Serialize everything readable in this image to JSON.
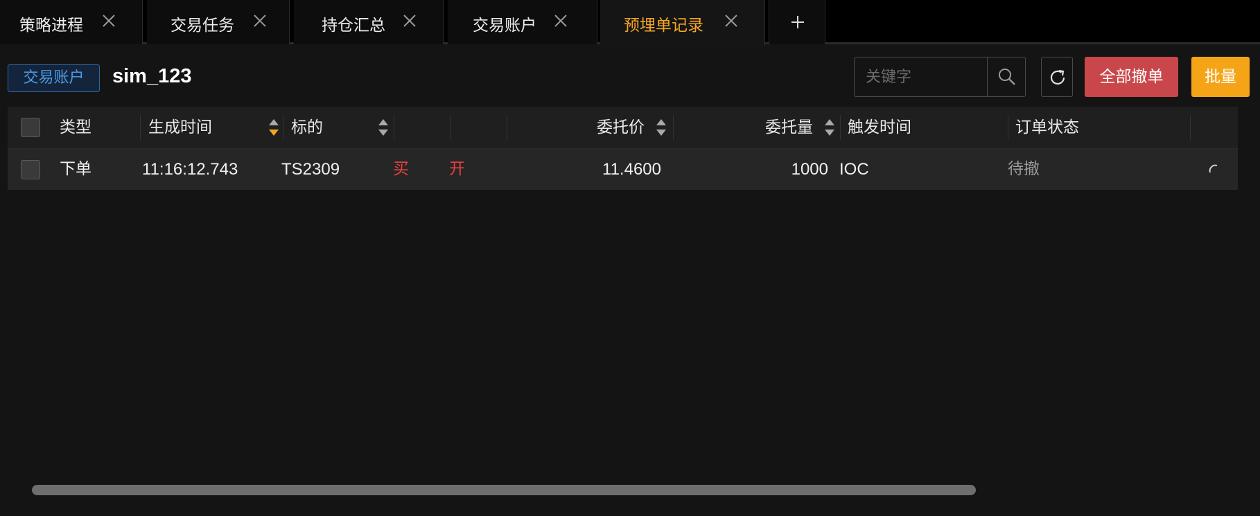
{
  "tabs": [
    {
      "label": "策略进程",
      "active": false
    },
    {
      "label": "交易任务",
      "active": false
    },
    {
      "label": "持仓汇总",
      "active": false
    },
    {
      "label": "交易账户",
      "active": false
    },
    {
      "label": "预埋单记录",
      "active": true
    }
  ],
  "toolbar": {
    "account_tag": "交易账户",
    "account_name": "sim_123",
    "search_placeholder": "关键字",
    "cancel_all_label": "全部撤单",
    "batch_label": "批量"
  },
  "table": {
    "columns": [
      "类型",
      "生成时间",
      "标的",
      "",
      "",
      "委托价",
      "委托量",
      "触发时间",
      "订单状态"
    ],
    "sorted_column": "生成时间",
    "rows": [
      {
        "type": "下单",
        "created_time": "11:16:12.743",
        "symbol": "TS2309",
        "direction": "买",
        "offset": "开",
        "price": "11.4600",
        "quantity": "1000",
        "trigger": "IOC",
        "status": "待撤"
      }
    ]
  },
  "colors": {
    "accent_active_tab": "#f5a623",
    "buy_red": "#e8413e",
    "cancel_all_red": "#c9474a",
    "batch_orange": "#f5a418",
    "account_tag_blue": "#4a9ae8"
  }
}
